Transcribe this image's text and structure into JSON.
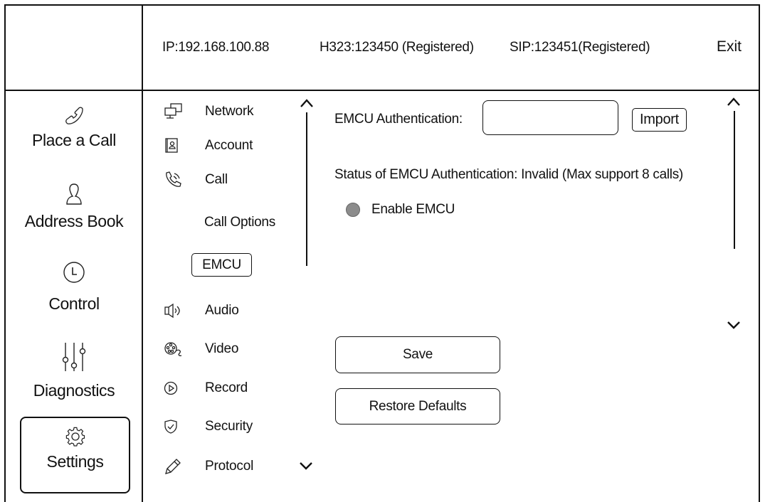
{
  "header": {
    "ip": "IP:192.168.100.88",
    "h323": "H323:123450 (Registered)",
    "sip": "SIP:123451(Registered)",
    "exit": "Exit"
  },
  "sidebar": {
    "items": [
      {
        "label": "Place a Call",
        "icon": "phone-icon"
      },
      {
        "label": "Address Book",
        "icon": "person-icon"
      },
      {
        "label": "Control",
        "icon": "clock-icon"
      },
      {
        "label": "Diagnostics",
        "icon": "sliders-icon"
      },
      {
        "label": "Settings",
        "icon": "gear-icon",
        "active": true
      }
    ]
  },
  "submenu": {
    "items": [
      {
        "label": "Network",
        "icon": "network-icon"
      },
      {
        "label": "Account",
        "icon": "account-icon"
      },
      {
        "label": "Call",
        "icon": "call-icon"
      },
      {
        "label": "Call Options"
      },
      {
        "label": "EMCU",
        "selected": true
      },
      {
        "label": "Audio",
        "icon": "speaker-icon"
      },
      {
        "label": "Video",
        "icon": "video-icon"
      },
      {
        "label": "Record",
        "icon": "record-icon"
      },
      {
        "label": "Security",
        "icon": "shield-icon"
      },
      {
        "label": "Protocol",
        "icon": "pencil-icon"
      }
    ]
  },
  "content": {
    "auth_label": "EMCU Authentication:",
    "auth_value": "",
    "import_label": "Import",
    "status_text": "Status of EMCU Authentication: Invalid (Max support 8 calls)",
    "enable_label": "Enable EMCU",
    "enable_checked": false,
    "save_label": "Save",
    "restore_label": "Restore Defaults"
  }
}
